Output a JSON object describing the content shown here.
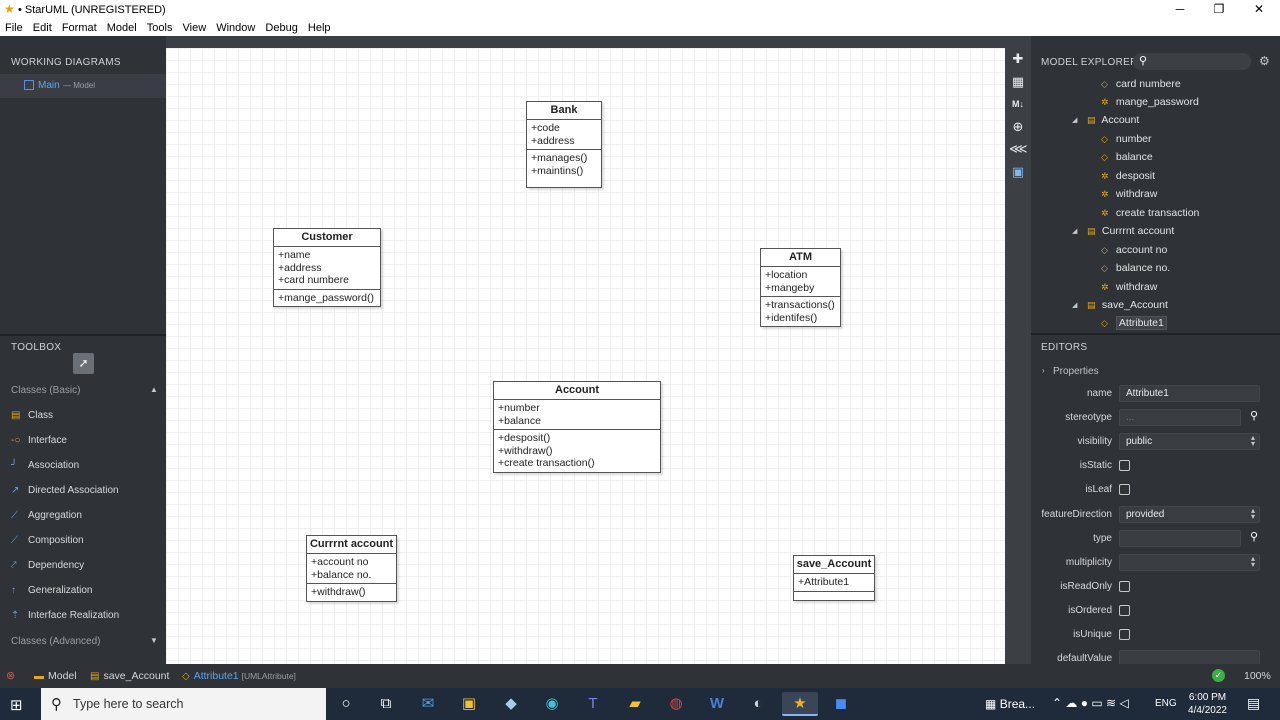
{
  "window": {
    "title": "• StarUML (UNREGISTERED)",
    "minimize": "─",
    "maximize": "❐",
    "close": "✕"
  },
  "menu": [
    "File",
    "Edit",
    "Format",
    "Model",
    "Tools",
    "View",
    "Window",
    "Debug",
    "Help"
  ],
  "working_diagrams": {
    "title": "WORKING DIAGRAMS",
    "item": {
      "name": "Main",
      "sub": "— Model"
    }
  },
  "toolbox": {
    "title": "TOOLBOX",
    "group": "Classes (Basic)",
    "items": [
      "Class",
      "Interface",
      "Association",
      "Directed Association",
      "Aggregation",
      "Composition",
      "Dependency",
      "Generalization",
      "Interface Realization"
    ],
    "advanced": "Classes (Advanced)"
  },
  "diagram": {
    "classes": [
      {
        "name": "Bank",
        "attributes": [
          "+code",
          "+address"
        ],
        "operations": [
          "+manages()",
          "+maintins()"
        ]
      },
      {
        "name": "Customer",
        "attributes": [
          "+name",
          "+address",
          "+card numbere"
        ],
        "operations": [
          "+mange_password()"
        ]
      },
      {
        "name": "ATM",
        "attributes": [
          "+location",
          "+mangeby"
        ],
        "operations": [
          "+transactions()",
          "+identifes()"
        ]
      },
      {
        "name": "Account",
        "attributes": [
          "+number",
          "+balance"
        ],
        "operations": [
          "+desposit()",
          "+withdraw()",
          "+create transaction()"
        ]
      },
      {
        "name": "Currrnt account",
        "attributes": [
          "+account no",
          "+balance no."
        ],
        "operations": [
          "+withdraw()"
        ]
      },
      {
        "name": "save_Account",
        "attributes": [
          "+Attribute1"
        ],
        "operations": []
      }
    ]
  },
  "model_explorer": {
    "title": "MODEL EXPLORER",
    "items": [
      {
        "label": "card numbere",
        "kind": "attribute",
        "level": 2
      },
      {
        "label": "mange_password",
        "kind": "operation",
        "level": 2
      },
      {
        "label": "Account",
        "kind": "class",
        "level": 1
      },
      {
        "label": "number",
        "kind": "attribute",
        "level": 2
      },
      {
        "label": "balance",
        "kind": "attribute",
        "level": 2
      },
      {
        "label": "desposit",
        "kind": "operation",
        "level": 2
      },
      {
        "label": "withdraw",
        "kind": "operation",
        "level": 2
      },
      {
        "label": "create transaction",
        "kind": "operation",
        "level": 2
      },
      {
        "label": "Currrnt account",
        "kind": "class",
        "level": 1
      },
      {
        "label": "account no",
        "kind": "attribute",
        "level": 2
      },
      {
        "label": "balance no.",
        "kind": "attribute",
        "level": 2
      },
      {
        "label": "withdraw",
        "kind": "operation",
        "level": 2
      },
      {
        "label": "save_Account",
        "kind": "class",
        "level": 1
      },
      {
        "label": "Attribute1",
        "kind": "attribute",
        "level": 2,
        "selected": true
      }
    ]
  },
  "editors": {
    "title": "EDITORS",
    "section": "Properties",
    "props": {
      "name": {
        "label": "name",
        "value": "Attribute1"
      },
      "stereotype": {
        "label": "stereotype",
        "value": "..."
      },
      "visibility": {
        "label": "visibility",
        "value": "public"
      },
      "isStatic": {
        "label": "isStatic"
      },
      "isLeaf": {
        "label": "isLeaf"
      },
      "featureDirection": {
        "label": "featureDirection",
        "value": "provided"
      },
      "type": {
        "label": "type",
        "value": ""
      },
      "multiplicity": {
        "label": "multiplicity",
        "value": ""
      },
      "isReadOnly": {
        "label": "isReadOnly"
      },
      "isOrdered": {
        "label": "isOrdered"
      },
      "isUnique": {
        "label": "isUnique"
      },
      "defaultValue": {
        "label": "defaultValue",
        "value": ""
      }
    }
  },
  "statusbar": {
    "model": "Model",
    "diagram": "save_Account",
    "element": "Attribute1",
    "element_type": "[UMLAttribute]",
    "zoom": "100%"
  },
  "taskbar": {
    "search_placeholder": "Type here to search",
    "news": "Brea...",
    "lang": "ENG",
    "time": "6:00 PM",
    "date": "4/4/2022"
  }
}
